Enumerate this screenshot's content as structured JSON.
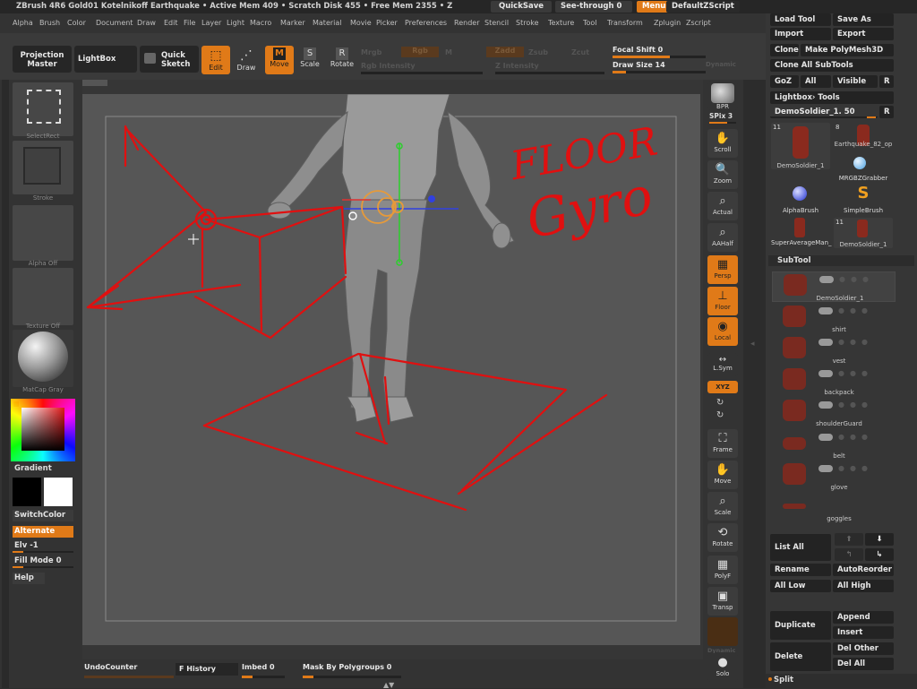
{
  "titlebar": {
    "title": "ZBrush 4R6 Gold01   Kotelnikoff Earthquake   • Active Mem 409  • Scratch Disk 455  • Free Mem 2355  • Z",
    "quicksave": "QuickSave",
    "seethrough": "See-through  0",
    "menus": "Menus",
    "script": "DefaultZScript"
  },
  "menubar": [
    "Alpha",
    "Brush",
    "Color",
    "Document",
    "Draw",
    "Edit",
    "File",
    "Layer",
    "Light",
    "Macro",
    "Marker",
    "Material",
    "Movie",
    "Picker",
    "Preferences",
    "Render",
    "Stencil",
    "Stroke",
    "Texture",
    "Tool",
    "Transform",
    "Zplugin",
    "Zscript"
  ],
  "toolbar": {
    "projection_master": "Projection Master",
    "lightbox": "LightBox",
    "quick_sketch": "Quick Sketch",
    "edit": "Edit",
    "draw": "Draw",
    "move": "Move",
    "scale": "Scale",
    "rotate": "Rotate",
    "mrgb": "Mrgb",
    "rgb": "Rgb",
    "m": "M",
    "zadd": "Zadd",
    "zsub": "Zsub",
    "zcut": "Zcut",
    "rgb_intensity": "Rgb Intensity",
    "z_intensity": "Z Intensity",
    "focal_shift": "Focal Shift 0",
    "draw_size": "Draw Size 14",
    "dynamic": "Dynamic"
  },
  "left": {
    "select_rect": "SelectRect",
    "stroke": "Stroke",
    "alpha": "Alpha Off",
    "texture": "Texture Off",
    "material": "MatCap Gray",
    "gradient": "Gradient",
    "switchcolor": "SwitchColor",
    "alternate": "Alternate",
    "elv": "Elv -1",
    "fill_mode": "Fill Mode 0",
    "help": "Help"
  },
  "colors": {
    "accent": "#e07a18",
    "annotation": "#e01010",
    "canvas": "#565656",
    "panel": "#363636"
  },
  "right_shelf": {
    "bpr": "BPR",
    "spix": "SPix 3",
    "scroll": "Scroll",
    "zoom": "Zoom",
    "actual": "Actual",
    "aahalf": "AAHalf",
    "persp": "Persp",
    "floor": "Floor",
    "local": "Local",
    "lsym": "L.Sym",
    "xyz": "XYZ",
    "frame": "Frame",
    "move": "Move",
    "scale": "Scale",
    "rotate": "Rotate",
    "polyf": "PolyF",
    "transp": "Transp",
    "dynamic": "Dynamic",
    "solo": "Solo"
  },
  "tool": {
    "load_tool": "Load Tool",
    "save_as": "Save As",
    "import": "Import",
    "export": "Export",
    "clone": "Clone",
    "make_polymesh": "Make PolyMesh3D",
    "clone_all": "Clone All SubTools",
    "goz": "GoZ",
    "all": "All",
    "visible": "Visible",
    "r": "R",
    "lightbox_tools": "Lightbox› Tools",
    "current_tool": "DemoSoldier_1. 50",
    "thumbs": [
      {
        "label": "DemoSoldier_1",
        "count": "11"
      },
      {
        "label": "Earthquake_82_op",
        "count": "8"
      },
      {
        "label": "MRGBZGrabber",
        "count": ""
      },
      {
        "label": "AlphaBrush",
        "count": ""
      },
      {
        "label": "SimpleBrush",
        "count": ""
      },
      {
        "label": "SuperAverageMan_",
        "count": ""
      },
      {
        "label": "DemoSoldier_1",
        "count": "11"
      }
    ]
  },
  "subtool": {
    "title": "SubTool",
    "items": [
      "DemoSoldier_1",
      "shirt",
      "vest",
      "backpack",
      "shoulderGuard",
      "belt",
      "glove",
      "goggles"
    ],
    "list_all": "List All",
    "rename": "Rename",
    "autoreorder": "AutoReorder",
    "all_low": "All Low",
    "all_high": "All High",
    "duplicate": "Duplicate",
    "append": "Append",
    "insert": "Insert",
    "delete": "Delete",
    "del_other": "Del Other",
    "del_all": "Del All",
    "split": "Split"
  },
  "bottom": {
    "undo": "UndoCounter",
    "history": "F History",
    "imbed": "Imbed 0",
    "mask": "Mask By Polygroups 0"
  },
  "annotation_text": {
    "line1": "FLOOR",
    "line2": "Gyro"
  }
}
